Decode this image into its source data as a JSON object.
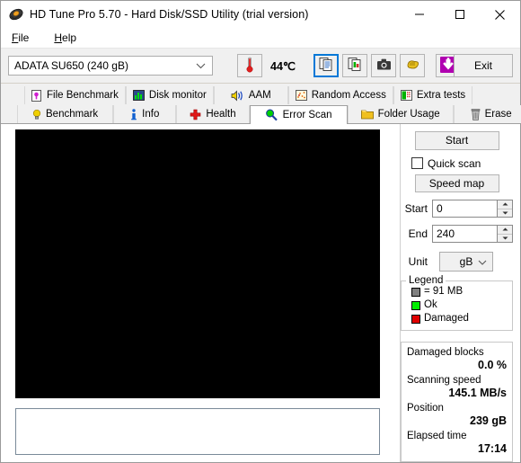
{
  "window": {
    "title": "HD Tune Pro 5.70 - Hard Disk/SSD Utility (trial version)",
    "icon": "harddisk-icon",
    "minimize_label": "–",
    "maximize_label": "☐",
    "close_label": "✕"
  },
  "menu": {
    "items": [
      {
        "label": "File",
        "accesskey": "F"
      },
      {
        "label": "Help",
        "accesskey": "H"
      }
    ]
  },
  "toolbar": {
    "drive": "ADATA SU650 (240 gB)",
    "temperature": "44℃",
    "temperature_icon": "thermometer-icon",
    "buttons": [
      {
        "name": "copy-report-button",
        "icon": "document-copy-icon",
        "selected": true
      },
      {
        "name": "copy-image-button",
        "icon": "document-image-icon",
        "selected": false
      },
      {
        "name": "screenshot-button",
        "icon": "camera-icon",
        "selected": false
      },
      {
        "name": "folder-button",
        "icon": "hand-icon",
        "selected": false
      },
      {
        "name": "save-button",
        "icon": "down-arrow-icon",
        "selected": false
      }
    ],
    "exit_label": "Exit"
  },
  "tabs": {
    "row1": [
      {
        "label": "File Benchmark",
        "icon": "file-benchmark-icon",
        "active": false
      },
      {
        "label": "Disk monitor",
        "icon": "bar-chart-icon",
        "active": false
      },
      {
        "label": "AAM",
        "icon": "speaker-icon",
        "active": false
      },
      {
        "label": "Random Access",
        "icon": "scatter-icon",
        "active": false
      },
      {
        "label": "Extra tests",
        "icon": "extra-chart-icon",
        "active": false
      }
    ],
    "row2": [
      {
        "label": "Benchmark",
        "icon": "lightbulb-icon",
        "active": false
      },
      {
        "label": "Info",
        "icon": "info-icon",
        "active": false
      },
      {
        "label": "Health",
        "icon": "redcross-icon",
        "active": false
      },
      {
        "label": "Error Scan",
        "icon": "magnifier-icon",
        "active": true
      },
      {
        "label": "Folder Usage",
        "icon": "folder-icon",
        "active": false
      },
      {
        "label": "Erase",
        "icon": "trash-icon",
        "active": false
      }
    ]
  },
  "panel": {
    "start_button": "Start",
    "quick_scan_label": "Quick scan",
    "quick_scan_checked": false,
    "speed_map_button": "Speed map",
    "fields": [
      {
        "label": "Start",
        "value": "0"
      },
      {
        "label": "End",
        "value": "240"
      }
    ],
    "unit_label": "Unit",
    "unit_value": "gB"
  },
  "legend": {
    "title": "Legend",
    "entries": [
      {
        "label": "= 91 MB",
        "color": "#808080"
      },
      {
        "label": "Ok",
        "color": "#00ee00"
      },
      {
        "label": "Damaged",
        "color": "#e00000"
      }
    ]
  },
  "stats": [
    {
      "label": "Damaged blocks",
      "value": "0.0 %"
    },
    {
      "label": "Scanning speed",
      "value": "145.1 MB/s"
    },
    {
      "label": "Position",
      "value": "239 gB"
    },
    {
      "label": "Elapsed time",
      "value": "17:14"
    }
  ],
  "blockmap": {
    "columns": 49,
    "rows": 56,
    "ok_color": "#00ee00",
    "grid_color": "#000000"
  },
  "log": {
    "text": ""
  }
}
